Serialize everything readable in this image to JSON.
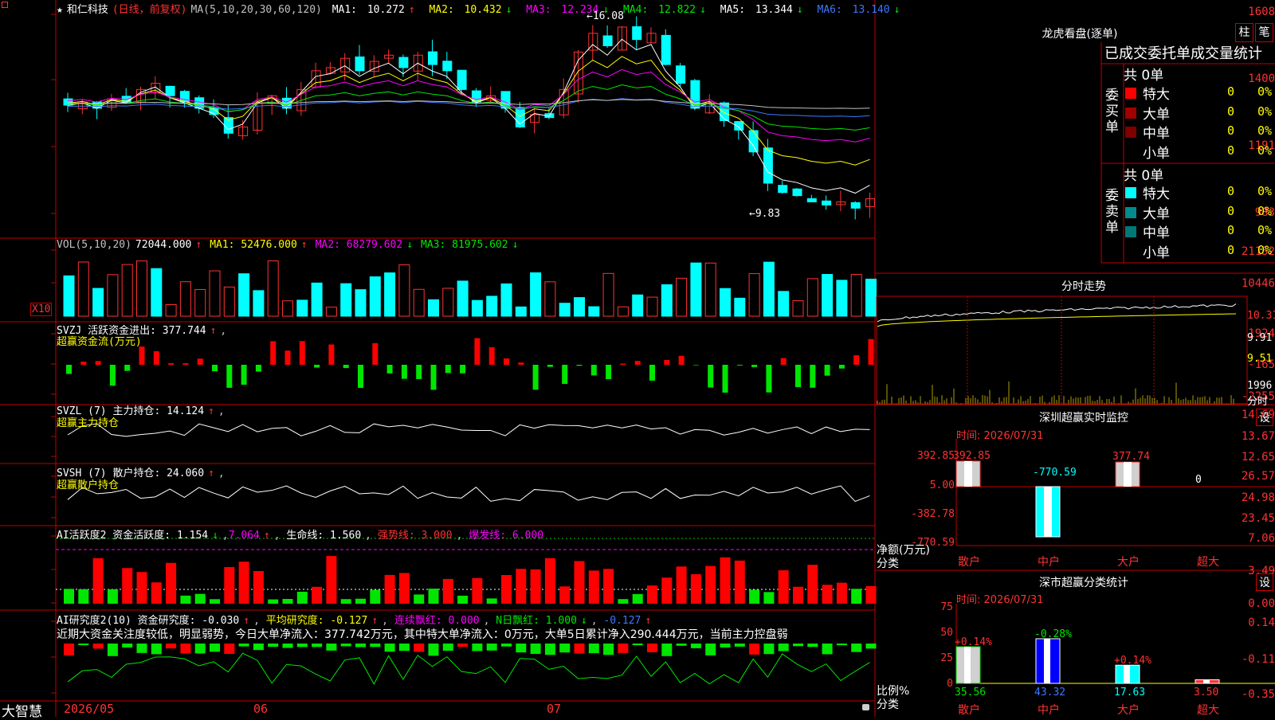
{
  "colors": {
    "up": "#ff3232",
    "down": "#00ffff",
    "grid": "#c00000",
    "ma5": "#ffffff",
    "ma10": "#ffff00",
    "ma20": "#ff00ff",
    "ma30": "#00e600",
    "ma60": "#3c78ff",
    "ma120": "#c0c0c0"
  },
  "stock": {
    "star": "★",
    "name": "和仁科技",
    "period": "(日线，前复权)",
    "ma_label": "MA(5,10,20,30,60,120)"
  },
  "ma": [
    {
      "label": "MA1:",
      "value": "10.272",
      "arrow": "↑"
    },
    {
      "label": "MA2:",
      "value": "10.432",
      "arrow": "↓"
    },
    {
      "label": "MA3:",
      "value": "12.234",
      "arrow": "↓"
    },
    {
      "label": "MA4:",
      "value": "12.822",
      "arrow": "↓"
    },
    {
      "label": "MA5:",
      "value": "13.344",
      "arrow": "↓"
    },
    {
      "label": "MA6:",
      "value": "13.140",
      "arrow": "↓"
    }
  ],
  "price_axis": [
    "1608",
    "1400",
    "1191",
    "983"
  ],
  "price_marks": {
    "high": "16.08",
    "low": "9.83"
  },
  "vol": {
    "label": "VOL(5,10,20)",
    "value": "72044.000",
    "arrow": "↑",
    "ma1": "MA1: 52476.000",
    "ma1a": "↑",
    "ma2": "MA2: 68279.602",
    "ma2a": "↓",
    "ma3": "MA3: 81975.602",
    "ma3a": "↓",
    "axis": [
      "21152",
      "10446"
    ],
    "unit": "X10"
  },
  "svzj": {
    "label": "SVZJ  活跃资金进出: 377.744",
    "arrow": "↑",
    "sub": "超赢资金流(万元)",
    "axis": [
      "1924",
      "-165",
      "-2255"
    ]
  },
  "svzl": {
    "label": "SVZL (7) 主力持仓: 14.124",
    "arrow": "↑",
    "sub": "超赢主力持仓",
    "axis": [
      "14.69",
      "13.67",
      "12.65"
    ]
  },
  "svsh": {
    "label": "SVSH (7) 散户持仓: 24.060",
    "arrow": "↑",
    "sub": "超赢散户持仓",
    "axis": [
      "26.57",
      "24.98",
      "23.45"
    ]
  },
  "ai1": {
    "label": "AI活跃度2 资金活跃度: 1.154",
    "arrow": "↓",
    "v2": "7.064",
    "a2": "↑",
    "life": "生命线: 1.560",
    "strong": "强势线: 3.000",
    "burst": "爆发线: 6.000",
    "axis": [
      "7.06",
      "3.49",
      "0.00"
    ]
  },
  "ai2": {
    "label": "AI研究度2(10) 资金研究度: -0.030",
    "arrow": "↑",
    "avg": "平均研究度: -0.127",
    "avga": "↑",
    "red": "连续飘红: 0.000",
    "nred": "N日飘红: 1.000",
    "nreda": "↓",
    "v": "-0.127",
    "va": "↑",
    "comment": "近期大资金关注度较低，明显弱势，今日大单净流入：377.742万元，其中特大单净流入：0万元，大单5日累计净入290.444万元，当前主力控盘弱",
    "axis": [
      "0.14",
      "-0.11",
      "-0.35"
    ]
  },
  "date_axis": [
    "2026/05",
    "06",
    "07"
  ],
  "bottom_left": "大智慧",
  "longhu": {
    "title": "龙虎看盘(逐单)",
    "btn1": "柱",
    "btn2": "笔",
    "tab_label": "已成交委托单成交量统计",
    "buy_side": "委买单",
    "sell_side": "委卖单",
    "buy_total": "共 0单",
    "sell_total": "共 0单",
    "buy_rows": [
      {
        "label": "特大",
        "v": "0",
        "p": "0%",
        "c": "#ff0000"
      },
      {
        "label": "大单",
        "v": "0",
        "p": "0%",
        "c": "#a00000"
      },
      {
        "label": "中单",
        "v": "0",
        "p": "0%",
        "c": "#800000"
      },
      {
        "label": "小单",
        "v": "0",
        "p": "0%",
        "c": ""
      }
    ],
    "sell_rows": [
      {
        "label": "特大",
        "v": "0",
        "p": "0%",
        "c": "#00ffff"
      },
      {
        "label": "大单",
        "v": "0",
        "p": "0%",
        "c": "#008c8c"
      },
      {
        "label": "中单",
        "v": "0",
        "p": "0%",
        "c": "#007878"
      },
      {
        "label": "小单",
        "v": "0",
        "p": "0%",
        "c": ""
      }
    ]
  },
  "intraday": {
    "title": "分时走势",
    "axis": [
      "10.31",
      "9.91",
      "9.51",
      "1996"
    ],
    "vol_label": "分时"
  },
  "monitor": {
    "title": "深圳超赢实时监控",
    "btn": "设",
    "time": "时间: 2026/07/31",
    "axis": [
      "392.85",
      "5.00",
      "-382.78",
      "-770.59"
    ],
    "ylabel": "净额(万元)",
    "xlabel": "分类",
    "cats": [
      "散户",
      "中户",
      "大户",
      "超大"
    ],
    "values": [
      392.85,
      -770.59,
      377.74,
      0
    ],
    "labels": [
      "392.85",
      "-770.59",
      "377.74",
      "0"
    ]
  },
  "classify": {
    "title": "深市超赢分类统计",
    "btn": "设",
    "time": "时间: 2026/07/31",
    "axis": [
      "75",
      "50",
      "25",
      "0"
    ],
    "ylabel": "比例%",
    "xlabel": "分类",
    "cats": [
      "散户",
      "中户",
      "大户",
      "超大"
    ],
    "values": [
      35.56,
      43.32,
      17.63,
      3.5
    ],
    "labels": [
      "35.56",
      "43.32",
      "17.63",
      "3.50"
    ],
    "changes": [
      "+0.14%",
      "-0.28%",
      "+0.14%",
      ""
    ]
  }
}
